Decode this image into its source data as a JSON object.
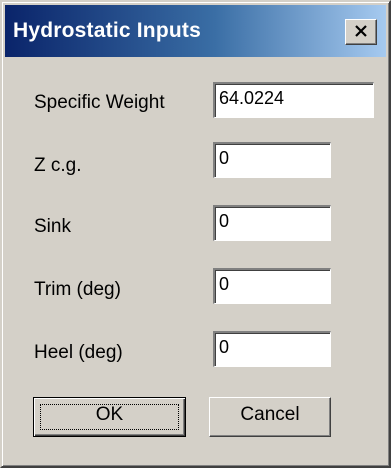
{
  "window": {
    "title": "Hydrostatic Inputs",
    "close_icon": "close-icon"
  },
  "colors": {
    "titlebar_start": "#0a246a",
    "titlebar_end": "#a6caf0",
    "face": "#d4d0c8"
  },
  "fields": [
    {
      "label": "Specific Weight",
      "value": "64.0224"
    },
    {
      "label": "Z c.g.",
      "value": "0"
    },
    {
      "label": "Sink",
      "value": "0"
    },
    {
      "label": "Trim (deg)",
      "value": "0"
    },
    {
      "label": "Heel (deg)",
      "value": "0"
    }
  ],
  "buttons": {
    "ok": "OK",
    "cancel": "Cancel"
  }
}
